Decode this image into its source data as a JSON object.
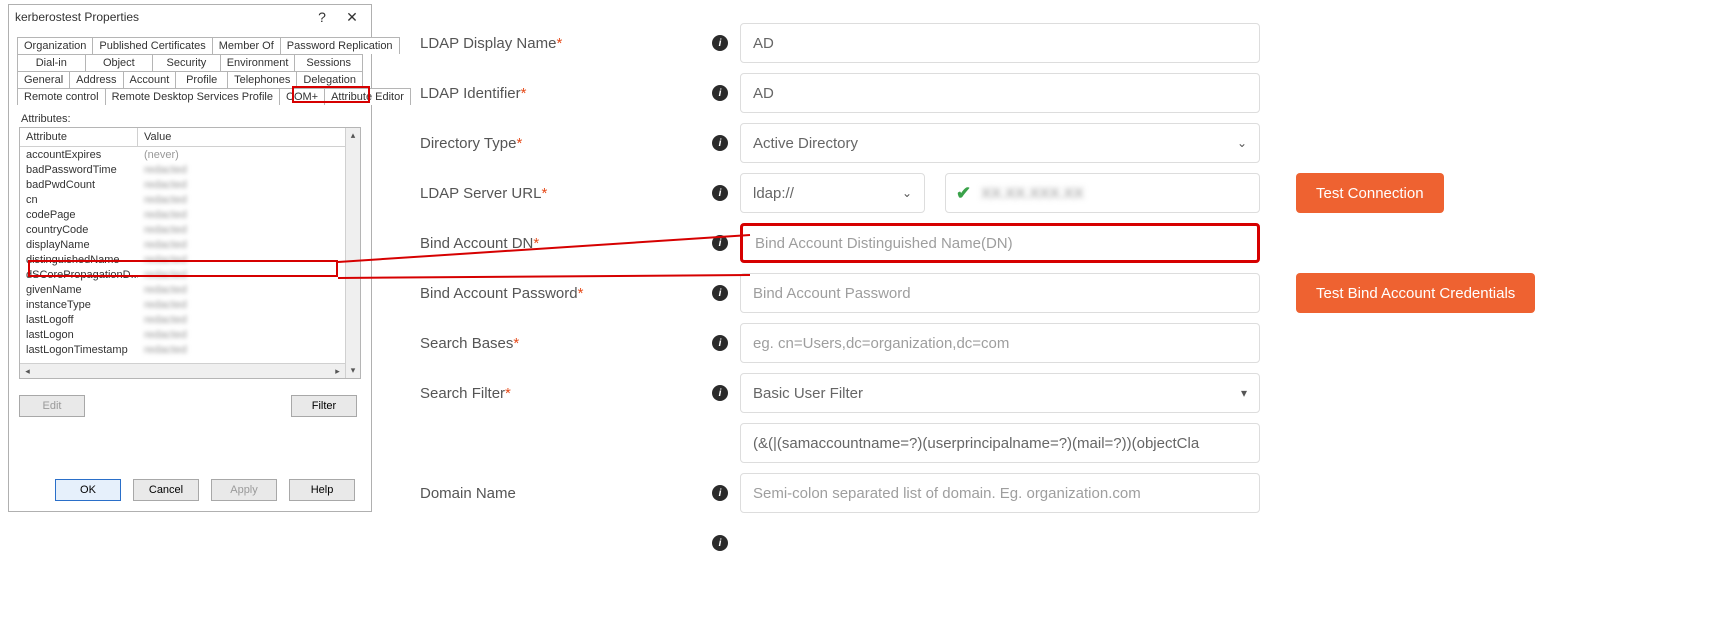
{
  "dialog": {
    "title": "kerberostest Properties",
    "tabs_row1": [
      "Organization",
      "Published Certificates",
      "Member Of",
      "Password Replication"
    ],
    "tabs_row2": [
      "Dial-in",
      "Object",
      "Security",
      "Environment",
      "Sessions"
    ],
    "tabs_row3": [
      "General",
      "Address",
      "Account",
      "Profile",
      "Telephones",
      "Delegation"
    ],
    "tabs_row4": [
      "Remote control",
      "Remote Desktop Services Profile",
      "COM+",
      "Attribute Editor"
    ],
    "attributes_label": "Attributes:",
    "col_attr": "Attribute",
    "col_val": "Value",
    "rows": [
      {
        "attr": "accountExpires",
        "val": "(never)",
        "clear": true
      },
      {
        "attr": "badPasswordTime",
        "val": "redacted"
      },
      {
        "attr": "badPwdCount",
        "val": "redacted"
      },
      {
        "attr": "cn",
        "val": "redacted"
      },
      {
        "attr": "codePage",
        "val": "redacted"
      },
      {
        "attr": "countryCode",
        "val": "redacted"
      },
      {
        "attr": "displayName",
        "val": "redacted"
      },
      {
        "attr": "distinguishedName",
        "val": "redacted"
      },
      {
        "attr": "dSCorePropagationD...",
        "val": "redacted"
      },
      {
        "attr": "givenName",
        "val": "redacted"
      },
      {
        "attr": "instanceType",
        "val": "redacted"
      },
      {
        "attr": "lastLogoff",
        "val": "redacted"
      },
      {
        "attr": "lastLogon",
        "val": "redacted"
      },
      {
        "attr": "lastLogonTimestamp",
        "val": "redacted"
      }
    ],
    "edit_btn": "Edit",
    "filter_btn": "Filter",
    "ok": "OK",
    "cancel": "Cancel",
    "apply": "Apply",
    "help": "Help"
  },
  "form": {
    "ldap_display_name": {
      "label": "LDAP Display Name",
      "value": "AD"
    },
    "ldap_identifier": {
      "label": "LDAP Identifier",
      "value": "AD"
    },
    "directory_type": {
      "label": "Directory Type",
      "value": "Active Directory"
    },
    "ldap_server_url": {
      "label": "LDAP Server URL",
      "proto": "ldap://",
      "host": "XX.XX.XXX.XX"
    },
    "test_connection": "Test Connection",
    "bind_dn": {
      "label": "Bind Account DN",
      "placeholder": "Bind Account Distinguished Name(DN)"
    },
    "bind_pw": {
      "label": "Bind Account Password",
      "placeholder": "Bind Account Password"
    },
    "test_bind": "Test Bind Account Credentials",
    "search_bases": {
      "label": "Search Bases",
      "placeholder": "eg. cn=Users,dc=organization,dc=com"
    },
    "search_filter": {
      "label": "Search Filter",
      "value": "Basic User Filter"
    },
    "filter_expr": "(&(|(samaccountname=?)(userprincipalname=?)(mail=?))(objectCla",
    "domain_name": {
      "label": "Domain Name",
      "placeholder": "Semi-colon separated list of domain. Eg. organization.com"
    }
  }
}
